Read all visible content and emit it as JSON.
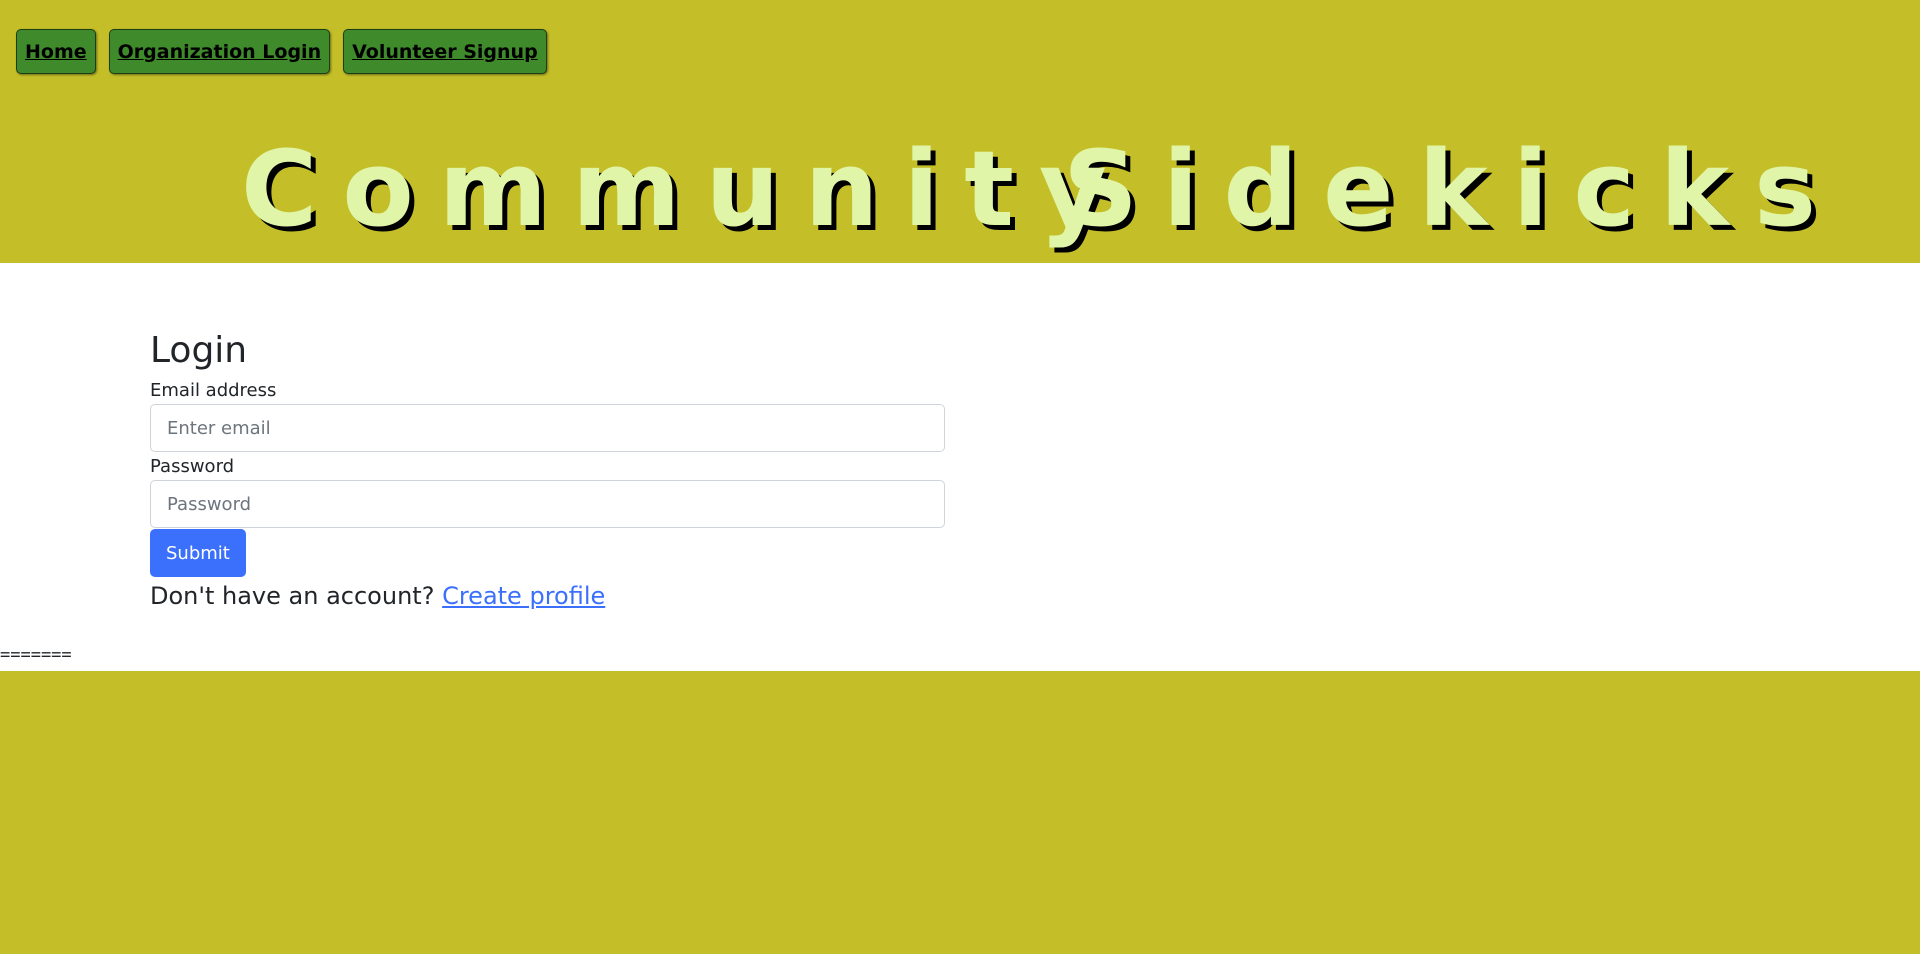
{
  "nav": {
    "home_label": "Home",
    "org_login_label": "Organization Login",
    "volunteer_signup_label": "Volunteer Signup"
  },
  "header": {
    "word1": "Community",
    "word2": "Sidekicks"
  },
  "login": {
    "title": "Login",
    "email_label": "Email address",
    "email_placeholder": "Enter email",
    "password_label": "Password",
    "password_placeholder": "Password",
    "submit_label": "Submit",
    "account_prompt": "Don't have an account?",
    "create_profile_label": "Create profile"
  },
  "separator_text": "=======",
  "colors": {
    "page_background": "#c4bf28",
    "nav_button": "#3f8a2a",
    "banner_letters": "#e0f5a8",
    "primary": "#3b70fd"
  }
}
